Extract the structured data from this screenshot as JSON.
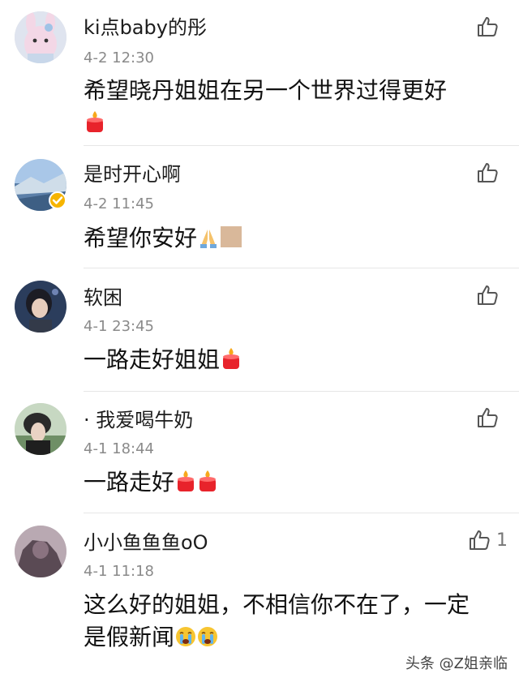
{
  "comments": [
    {
      "username": "ki点baby的彤",
      "time": "4-2 12:30",
      "content": "希望晓丹姐姐在另一个世界过得更好",
      "emojis": [
        "candle-icon"
      ],
      "likes": ""
    },
    {
      "username": "是时开心啊",
      "time": "4-2 11:45",
      "content": "希望你安好",
      "emojis": [
        "praying-hands-icon",
        "skin-tone-swatch-icon"
      ],
      "likes": "",
      "verified": true
    },
    {
      "username": "软困",
      "time": "4-1 23:45",
      "content": "一路走好姐姐",
      "emojis": [
        "candle-icon"
      ],
      "likes": ""
    },
    {
      "username": "· 我爱喝牛奶",
      "time": "4-1 18:44",
      "content": "一路走好",
      "emojis": [
        "candle-icon",
        "candle-icon"
      ],
      "likes": ""
    },
    {
      "username": "小小鱼鱼鱼oO",
      "time": "4-1 11:18",
      "content_line1": "这么好的姐姐，不相信你不在了，一定",
      "content_line2": "是假新闻",
      "emojis": [
        "crying-face-icon",
        "crying-face-icon"
      ],
      "likes": "1"
    }
  ],
  "watermark": "头条 @Z姐亲临",
  "colors": {
    "text": "#111111",
    "meta": "#8a8a8a",
    "divider": "#e6e6e6",
    "candle": "#e8232b",
    "flame": "#f7a81b",
    "verified_badge": "#f6b400"
  }
}
